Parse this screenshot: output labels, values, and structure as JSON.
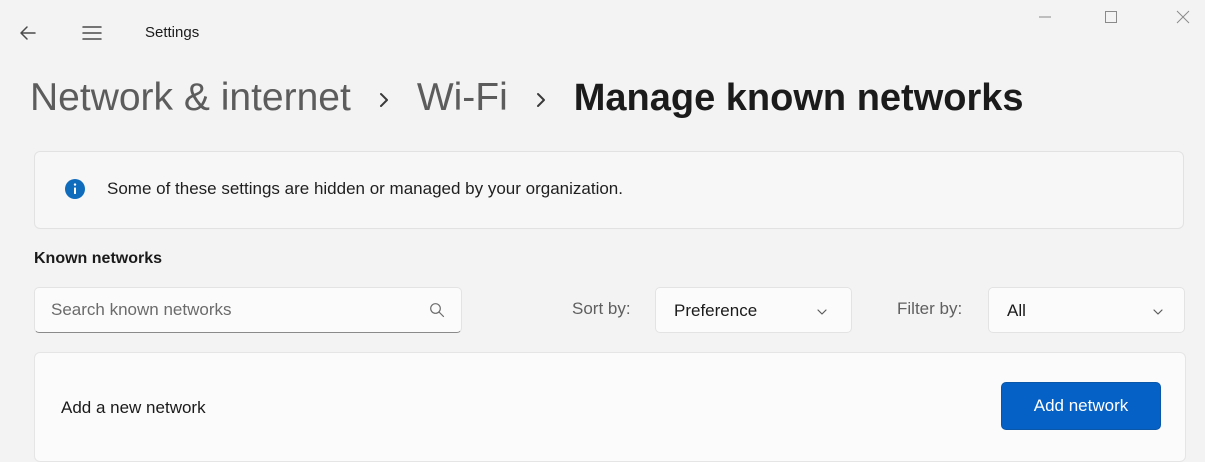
{
  "window": {
    "title": "Settings",
    "controls": {
      "minimize_icon": "minimize-icon",
      "maximize_icon": "maximize-icon",
      "close_icon": "close-icon"
    }
  },
  "breadcrumb": {
    "items": [
      "Network & internet",
      "Wi-Fi"
    ],
    "separator": "›",
    "current": "Manage known networks"
  },
  "info_bar": {
    "icon": "info-icon",
    "text": "Some of these settings are hidden or managed by your organization."
  },
  "known_networks": {
    "heading": "Known networks",
    "search": {
      "placeholder": "Search known networks",
      "value": ""
    },
    "sort": {
      "label": "Sort by:",
      "value": "Preference"
    },
    "filter": {
      "label": "Filter by:",
      "value": "All"
    }
  },
  "add_network": {
    "label": "Add a new network",
    "button_label": "Add network"
  },
  "colors": {
    "background": "#f3f3f3",
    "accent": "#0561c5",
    "info_icon": "#0f6cbd"
  }
}
